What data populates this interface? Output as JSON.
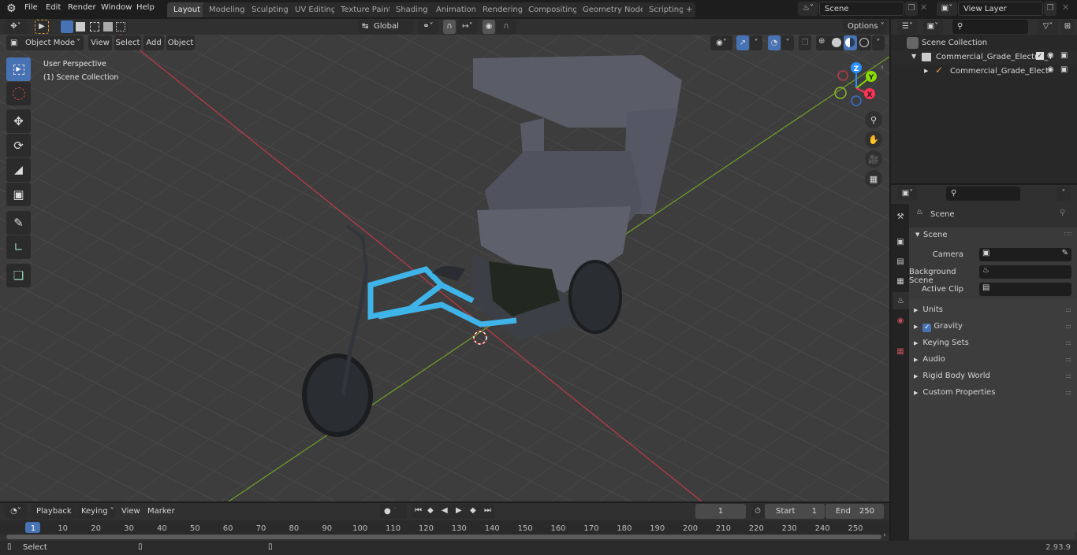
{
  "app": {
    "name": "Blender",
    "version": "2.93.9"
  },
  "menu": {
    "items": [
      "File",
      "Edit",
      "Render",
      "Window",
      "Help"
    ]
  },
  "workspaces": {
    "tabs": [
      "Layout",
      "Modeling",
      "Sculpting",
      "UV Editing",
      "Texture Paint",
      "Shading",
      "Animation",
      "Rendering",
      "Compositing",
      "Geometry Nodes",
      "Scripting"
    ],
    "active": "Layout",
    "add_label": "+"
  },
  "scene_selector": {
    "value": "Scene"
  },
  "view_layer_selector": {
    "value": "View Layer"
  },
  "viewport": {
    "mode": "Object Mode",
    "menus": [
      "View",
      "Select",
      "Add",
      "Object"
    ],
    "transform_orientation": "Global",
    "options_label": "Options",
    "overlay_text": [
      "User Perspective",
      "(1) Scene Collection"
    ],
    "gizmo_axes": {
      "x": "X",
      "y": "Y",
      "z": "Z"
    },
    "axis_colors": {
      "x": "#ff3352",
      "y": "#8bdc00",
      "z": "#2890ff"
    },
    "tools": [
      "select-box",
      "cursor",
      "move",
      "rotate",
      "scale",
      "transform",
      "annotate",
      "measure",
      "add-cube"
    ],
    "active_tool": "select-box",
    "shading_mode": "material-preview"
  },
  "outliner": {
    "search_placeholder": "",
    "items": [
      {
        "label": "Scene Collection",
        "type": "scene-collection",
        "depth": 0
      },
      {
        "label": "Commercial_Grade_Electric_T",
        "type": "collection",
        "depth": 1,
        "expanded": true,
        "checked": true
      },
      {
        "label": "Commercial_Grade_Elect",
        "type": "empty",
        "depth": 2,
        "expanded": false
      }
    ]
  },
  "properties": {
    "search_placeholder": "",
    "context_title": "Scene",
    "tabs": [
      "tool",
      "render",
      "output",
      "view-layer",
      "scene",
      "world",
      "texture"
    ],
    "active_tab": "scene",
    "scene_panel": {
      "title": "Scene",
      "fields": [
        {
          "label": "Camera",
          "value": ""
        },
        {
          "label": "Background Scene",
          "value": ""
        },
        {
          "label": "Active Clip",
          "value": ""
        }
      ]
    },
    "collapsed_panels": [
      {
        "label": "Units",
        "checkbox": false
      },
      {
        "label": "Gravity",
        "checkbox": true,
        "checked": true
      },
      {
        "label": "Keying Sets",
        "checkbox": false
      },
      {
        "label": "Audio",
        "checkbox": false
      },
      {
        "label": "Rigid Body World",
        "checkbox": false
      },
      {
        "label": "Custom Properties",
        "checkbox": false
      }
    ]
  },
  "timeline": {
    "menus": [
      "Playback",
      "Keying",
      "View",
      "Marker"
    ],
    "current_frame": "1",
    "start_label": "Start",
    "start": "1",
    "end_label": "End",
    "end": "250",
    "ruler_ticks": [
      "1",
      "10",
      "20",
      "30",
      "40",
      "50",
      "60",
      "70",
      "80",
      "90",
      "100",
      "110",
      "120",
      "130",
      "140",
      "150",
      "160",
      "170",
      "180",
      "190",
      "200",
      "210",
      "220",
      "230",
      "240",
      "250"
    ]
  },
  "statusbar": {
    "left_action": "Select",
    "version": "2.93.9"
  }
}
